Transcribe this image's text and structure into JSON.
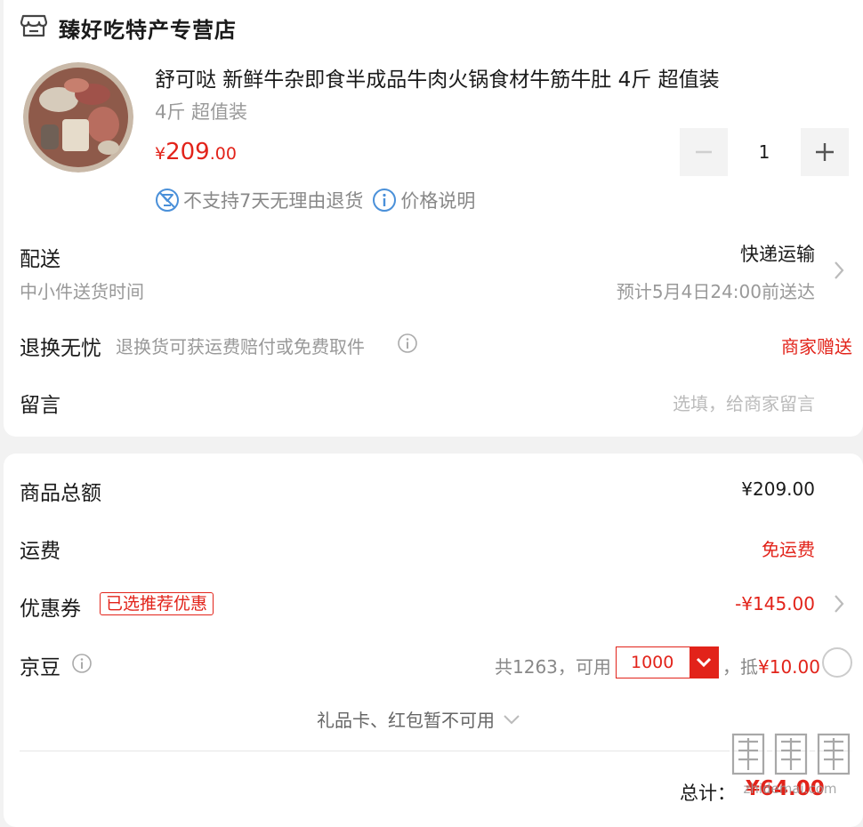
{
  "store": {
    "name": "臻好吃特产专营店"
  },
  "product": {
    "title": "舒可哒 新鲜牛杂即食半成品牛肉火锅食材牛筋牛肚 4斤 超值装",
    "spec": "4斤 超值装",
    "price_symbol": "¥",
    "price_int": "209",
    "price_dec": ".00",
    "quantity": "1",
    "tags": [
      "不支持7天无理由退货",
      "价格说明"
    ]
  },
  "delivery": {
    "label": "配送",
    "sub": "中小件送货时间",
    "method": "快递运输",
    "estimate": "预计5月4日24:00前送达"
  },
  "exchange": {
    "label": "退换无忧",
    "desc": "退换货可获运费赔付或免费取件",
    "value": "商家赠送"
  },
  "message": {
    "label": "留言",
    "placeholder": "选填，给商家留言"
  },
  "summary": {
    "goods_total_label": "商品总额",
    "goods_total": "¥209.00",
    "shipping_label": "运费",
    "shipping_value": "免运费",
    "coupon_label": "优惠券",
    "coupon_badge": "已选推荐优惠",
    "coupon_value": "-¥145.00",
    "beans_label": "京豆",
    "beans_total": "共1263，可用",
    "beans_selected": "1000",
    "beans_deduct_prefix": "，抵",
    "beans_deduct": "¥10.00",
    "giftcard_note": "礼品卡、红包暂不可用",
    "total_label": "总计：",
    "total_value": "¥64.00"
  },
  "watermark": {
    "text": "值值值",
    "sub": "zhidemai.com"
  },
  "colors": {
    "accent": "#e2231a",
    "muted": "#999999",
    "bg": "#f2f2f2"
  }
}
